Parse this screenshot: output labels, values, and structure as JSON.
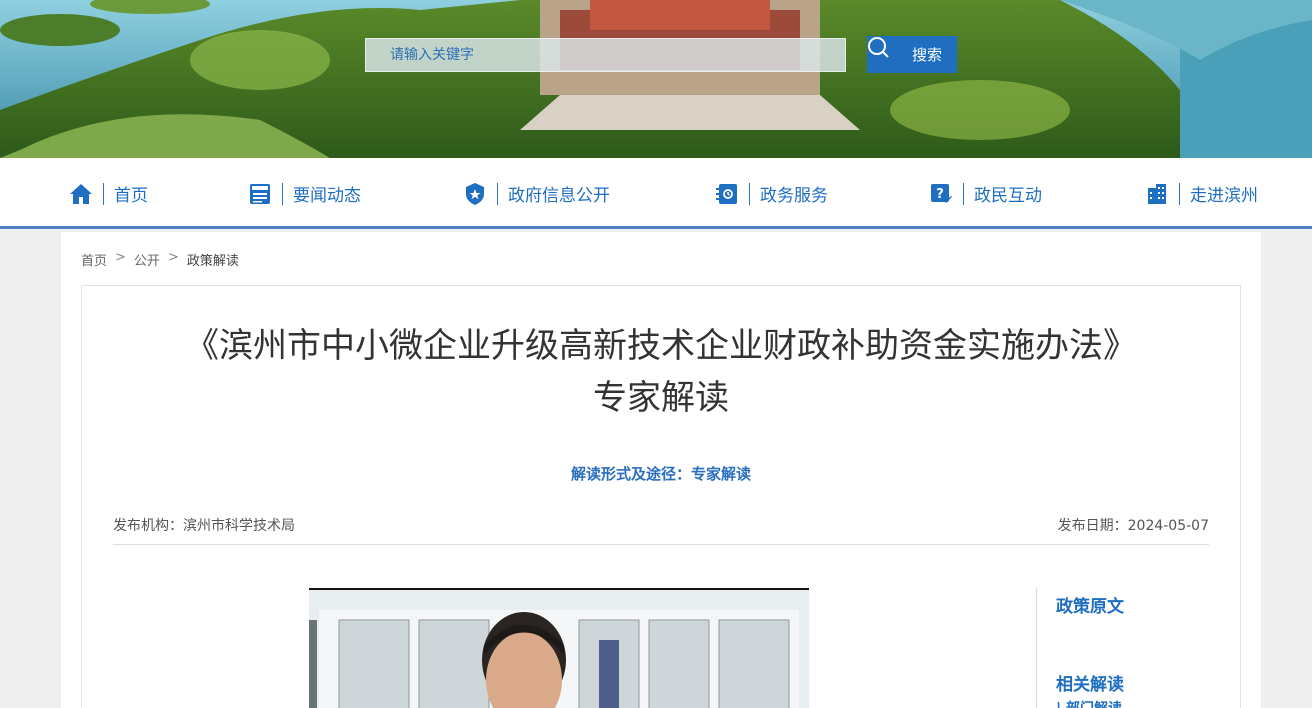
{
  "search": {
    "placeholder": "请输入关键字",
    "button_label": "搜索"
  },
  "nav": {
    "items": [
      {
        "label": "首页",
        "icon": "home-icon"
      },
      {
        "label": "要闻动态",
        "icon": "news-icon"
      },
      {
        "label": "政府信息公开",
        "icon": "badge-icon"
      },
      {
        "label": "政务服务",
        "icon": "service-icon"
      },
      {
        "label": "政民互动",
        "icon": "question-icon"
      },
      {
        "label": "走进滨州",
        "icon": "building-icon"
      }
    ]
  },
  "breadcrumb": {
    "home": "首页",
    "sep": ">",
    "section": "公开",
    "current": "政策解读"
  },
  "article": {
    "title_line1": "《滨州市中小微企业升级高新技术企业财政补助资金实施办法》",
    "title_line2": "专家解读",
    "subtitle": "解读形式及途径：专家解读",
    "publisher": "发布机构：滨州市科学技术局",
    "date": "发布日期：2024-05-07"
  },
  "sidebar": {
    "policy_original": "政策原文",
    "related": "相关解读",
    "dept_partial": "| 部门解读"
  },
  "colors": {
    "accent": "#1e6ec2",
    "nav_border": "#4e7fc1"
  }
}
